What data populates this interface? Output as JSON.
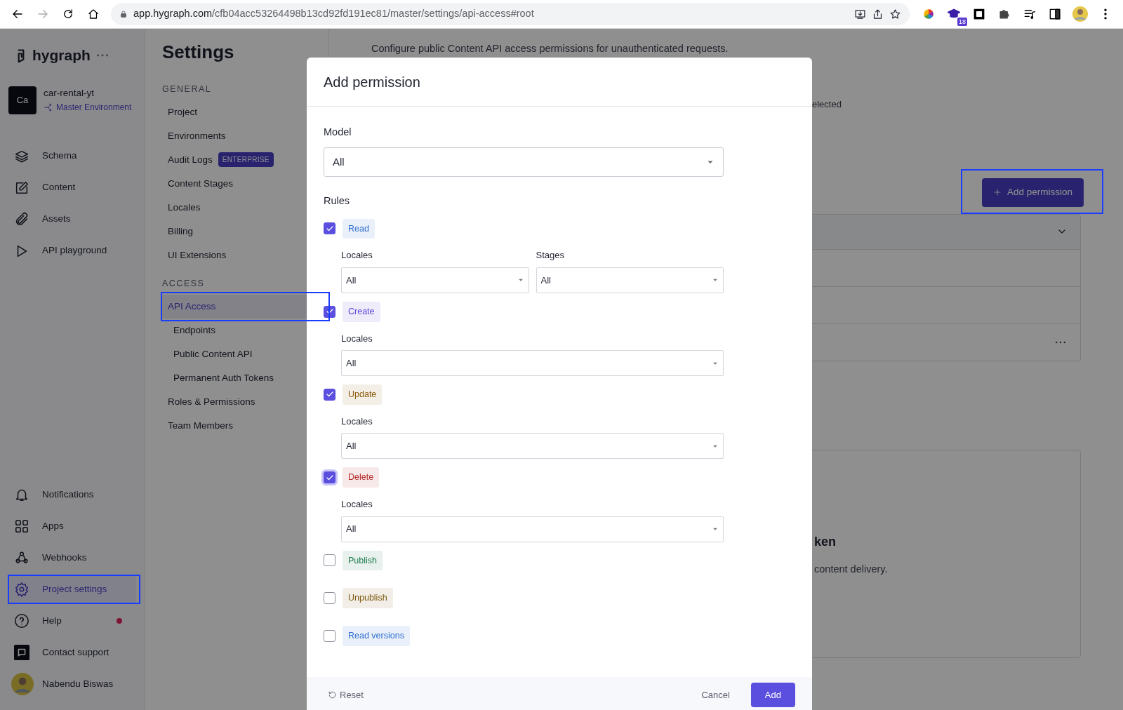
{
  "browser": {
    "url_host": "app.hygraph.com",
    "url_path": "/cfb04acc53264498b13cd92fd191ec81/master/settings/api-access#root",
    "extension_badge": "18"
  },
  "sidebar": {
    "logo": "hygraph",
    "project": {
      "avatar": "Ca",
      "name": "car-rental-yt",
      "environment": "Master Environment"
    },
    "top_items": [
      {
        "label": "Schema",
        "selected": false,
        "highlighted": false,
        "unread": false
      },
      {
        "label": "Content",
        "selected": false,
        "highlighted": false,
        "unread": false
      },
      {
        "label": "Assets",
        "selected": false,
        "highlighted": false,
        "unread": false
      },
      {
        "label": "API playground",
        "selected": false,
        "highlighted": false,
        "unread": false
      }
    ],
    "bottom_items": [
      {
        "label": "Notifications",
        "selected": false,
        "highlighted": false,
        "unread": false
      },
      {
        "label": "Apps",
        "selected": false,
        "highlighted": false,
        "unread": false
      },
      {
        "label": "Webhooks",
        "selected": false,
        "highlighted": false,
        "unread": false
      },
      {
        "label": "Project settings",
        "selected": true,
        "highlighted": true,
        "unread": false
      },
      {
        "label": "Help",
        "selected": false,
        "highlighted": false,
        "unread": true
      },
      {
        "label": "Contact support",
        "selected": false,
        "highlighted": false,
        "unread": false
      }
    ],
    "user": {
      "name": "Nabendu Biswas"
    }
  },
  "settings_nav": {
    "title": "Settings",
    "sections": [
      {
        "heading": "GENERAL",
        "items": [
          {
            "label": "Project",
            "selected": false,
            "highlighted": false
          },
          {
            "label": "Environments",
            "selected": false,
            "highlighted": false
          },
          {
            "label": "Audit Logs",
            "selected": false,
            "highlighted": false,
            "badge": "ENTERPRISE"
          },
          {
            "label": "Content Stages",
            "selected": false,
            "highlighted": false
          },
          {
            "label": "Locales",
            "selected": false,
            "highlighted": false
          },
          {
            "label": "Billing",
            "selected": false,
            "highlighted": false
          },
          {
            "label": "UI Extensions",
            "selected": false,
            "highlighted": false
          }
        ]
      },
      {
        "heading": "ACCESS",
        "items": [
          {
            "label": "API Access",
            "selected": true,
            "highlighted": true,
            "children": [
              {
                "label": "Endpoints",
                "selected": false,
                "highlighted": false
              },
              {
                "label": "Public Content API",
                "selected": false,
                "highlighted": false
              },
              {
                "label": "Permanent Auth Tokens",
                "selected": false,
                "highlighted": false
              }
            ]
          },
          {
            "label": "Roles & Permissions",
            "selected": false,
            "highlighted": false
          },
          {
            "label": "Team Members",
            "selected": false,
            "highlighted": false
          }
        ]
      }
    ]
  },
  "page": {
    "description": "Configure public Content API access permissions for unauthenticated requests.",
    "text_fragment": "elected",
    "add_button": {
      "label": "Add permission",
      "highlighted": true
    },
    "card_heading_fragment": "ken",
    "card_text_fragment": "content delivery."
  },
  "modal": {
    "title": "Add permission",
    "model": {
      "label": "Model",
      "value": "All"
    },
    "rules_label": "Rules",
    "rules": [
      {
        "label": "Read",
        "color": "#2f6fcf",
        "checked": true,
        "selects": [
          {
            "label": "Locales",
            "value": "All"
          },
          {
            "label": "Stages",
            "value": "All"
          }
        ]
      },
      {
        "label": "Create",
        "color": "#5a48d8",
        "checked": true,
        "selects": [
          {
            "label": "Locales",
            "value": "All"
          }
        ]
      },
      {
        "label": "Update",
        "color": "#8a5a0a",
        "checked": true,
        "selects": [
          {
            "label": "Locales",
            "value": "All"
          }
        ]
      },
      {
        "label": "Delete",
        "color": "#b42a2a",
        "checked": true,
        "focused": true,
        "selects": [
          {
            "label": "Locales",
            "value": "All"
          }
        ]
      },
      {
        "label": "Publish",
        "color": "#1d7a4c",
        "checked": false
      },
      {
        "label": "Unpublish",
        "color": "#7d5a10",
        "checked": false
      },
      {
        "label": "Read versions",
        "color": "#2f6fcf",
        "checked": false
      }
    ],
    "footer": {
      "reset": "Reset",
      "cancel": "Cancel",
      "add": "Add"
    }
  }
}
